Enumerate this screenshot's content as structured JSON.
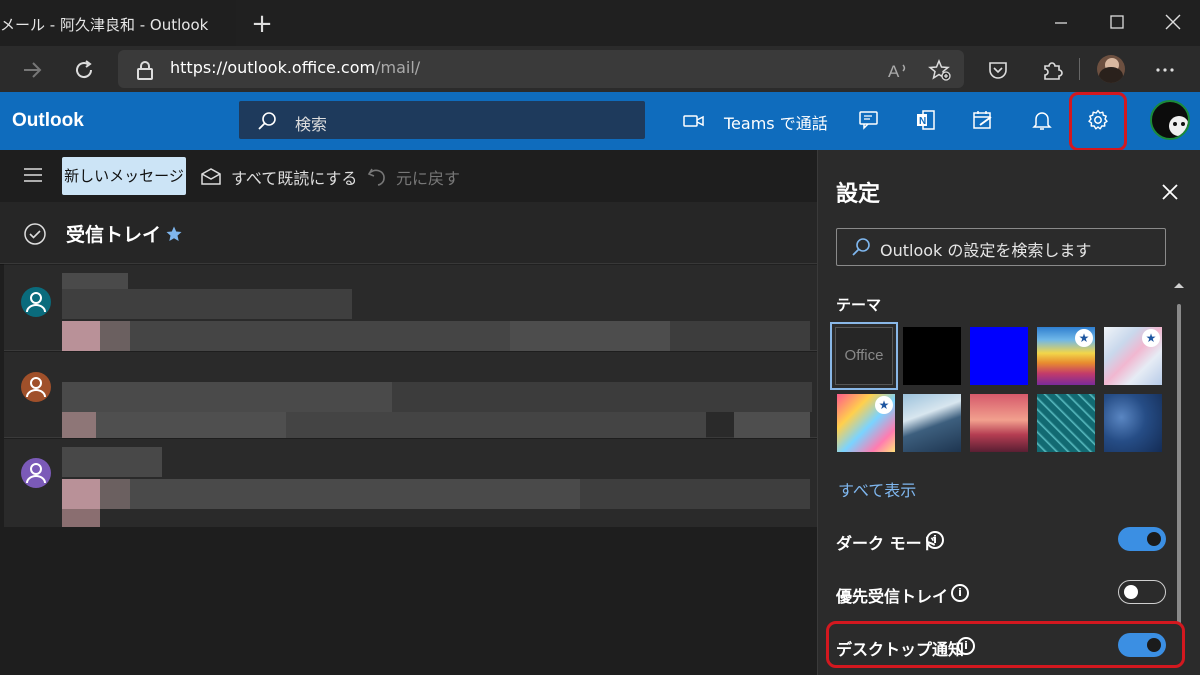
{
  "browser": {
    "tab_title": "メール - 阿久津良和 - Outlook",
    "new_tab_symbol": "+",
    "url_host": "https://outlook.office.com",
    "url_path": "/mail/"
  },
  "owa": {
    "brand": "Outlook",
    "search_placeholder": "検索",
    "teams_label": "Teams で通話",
    "accent_color": "#0f6cbd",
    "highlight_color": "#d3181f"
  },
  "command_bar": {
    "new_message": "新しいメッセージ",
    "mark_all_read": "すべて既読にする",
    "undo": "元に戻す"
  },
  "folder": {
    "title": "受信トレイ"
  },
  "messages": [
    {
      "avatar_color": "#0a6b7c"
    },
    {
      "avatar_color": "#a0502a"
    },
    {
      "avatar_color": "#7b5ab8"
    }
  ],
  "settings": {
    "title": "設定",
    "search_placeholder": "Outlook の設定を検索します",
    "theme_label": "テーマ",
    "themes": [
      "Office",
      "black",
      "blue",
      "rainbow",
      "abstract",
      "anime",
      "mountain",
      "palms",
      "circuit",
      "innovation"
    ],
    "show_all": "すべて表示",
    "dark_mode_label": "ダーク モード",
    "dark_mode_on": true,
    "focused_inbox_label": "優先受信トレイ",
    "focused_inbox_on": false,
    "desktop_notifications_label": "デスクトップ通知",
    "desktop_notifications_on": true
  }
}
